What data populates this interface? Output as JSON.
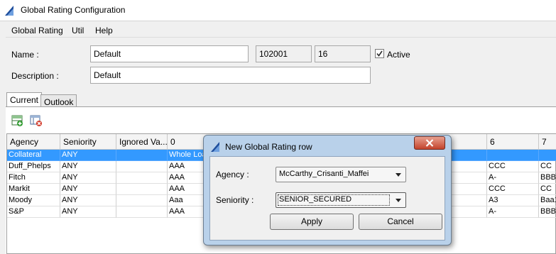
{
  "window": {
    "title": "Global Rating Configuration",
    "icon": "app-logo-icon"
  },
  "menu": {
    "items": [
      "Global Rating",
      "Util",
      "Help"
    ]
  },
  "form": {
    "name_label": "Name :",
    "name_value": "Default",
    "id_value": "102001",
    "num_value": "16",
    "active_checked": true,
    "active_label": "Active",
    "description_label": "Description :",
    "description_value": "Default"
  },
  "tabs": [
    "Current",
    "Outlook"
  ],
  "toolbar": {
    "icons": [
      "add-row-icon",
      "delete-row-icon"
    ]
  },
  "grid": {
    "columns": [
      "Agency",
      "Seniority",
      "Ignored Va...",
      "0",
      "6",
      "7"
    ],
    "rows": [
      {
        "agency": "Collateral",
        "seniority": "ANY",
        "ignored": "",
        "c0": "Whole Loa",
        "c6": "",
        "c7": "",
        "selected": true
      },
      {
        "agency": "Duff_Phelps",
        "seniority": "ANY",
        "ignored": "",
        "c0": "AAA",
        "c6": "CCC",
        "c7": "CC",
        "selected": false
      },
      {
        "agency": "Fitch",
        "seniority": "ANY",
        "ignored": "",
        "c0": "AAA",
        "c6": "A-",
        "c7": "BBB-",
        "selected": false
      },
      {
        "agency": "Markit",
        "seniority": "ANY",
        "ignored": "",
        "c0": "AAA",
        "c6": "CCC",
        "c7": "CC",
        "selected": false
      },
      {
        "agency": "Moody",
        "seniority": "ANY",
        "ignored": "",
        "c0": "Aaa",
        "c6": "A3",
        "c7": "Baa1",
        "selected": false
      },
      {
        "agency": "S&P",
        "seniority": "ANY",
        "ignored": "",
        "c0": "AAA",
        "c6": "A-",
        "c7": "BBB-",
        "selected": false
      }
    ]
  },
  "dialog": {
    "title": "New Global Rating row",
    "agency_label": "Agency :",
    "agency_value": "McCarthy_Crisanti_Maffei",
    "seniority_label": "Seniority :",
    "seniority_value": "SENIOR_SECURED",
    "apply_label": "Apply",
    "cancel_label": "Cancel"
  },
  "colors": {
    "selection": "#3399ff",
    "dialog_frame": "#b9d1ea",
    "close_button": "#c3432b"
  }
}
